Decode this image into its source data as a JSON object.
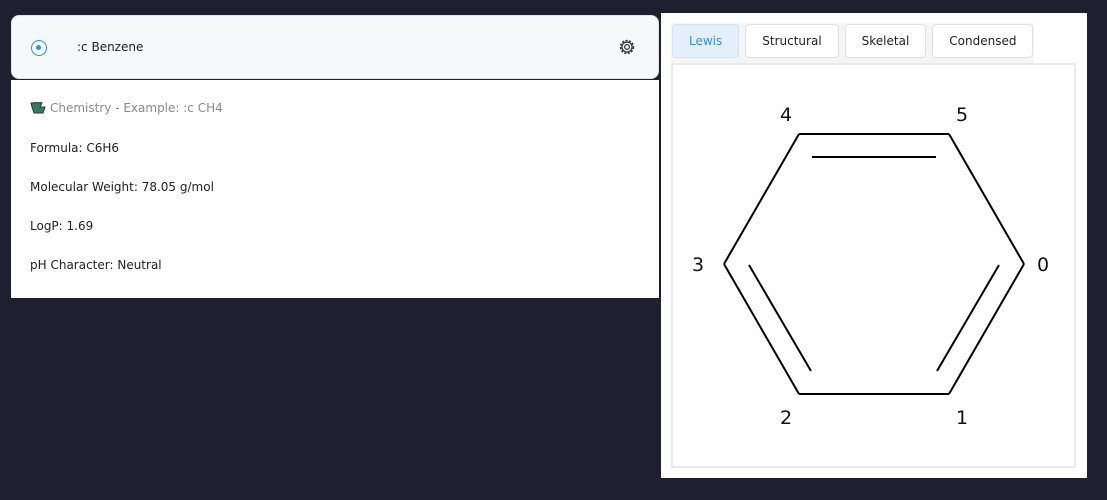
{
  "search": {
    "query": ":c Benzene",
    "radio_icon": "radio-selected-icon",
    "settings_icon": "gear-icon"
  },
  "result": {
    "header": "Chemistry - Example: :c CH4",
    "header_icon": "flask-icon",
    "lines": [
      "Formula: C6H6",
      "Molecular Weight: 78.05 g/mol",
      "LogP: 1.69",
      "pH Character: Neutral"
    ]
  },
  "molecule": {
    "tabs": [
      "Lewis",
      "Structural",
      "Skeletal",
      "Condensed"
    ],
    "active_tab": "Lewis",
    "atom_labels": [
      "0",
      "1",
      "2",
      "3",
      "4",
      "5"
    ],
    "accent_color": "#3a8fd6"
  }
}
